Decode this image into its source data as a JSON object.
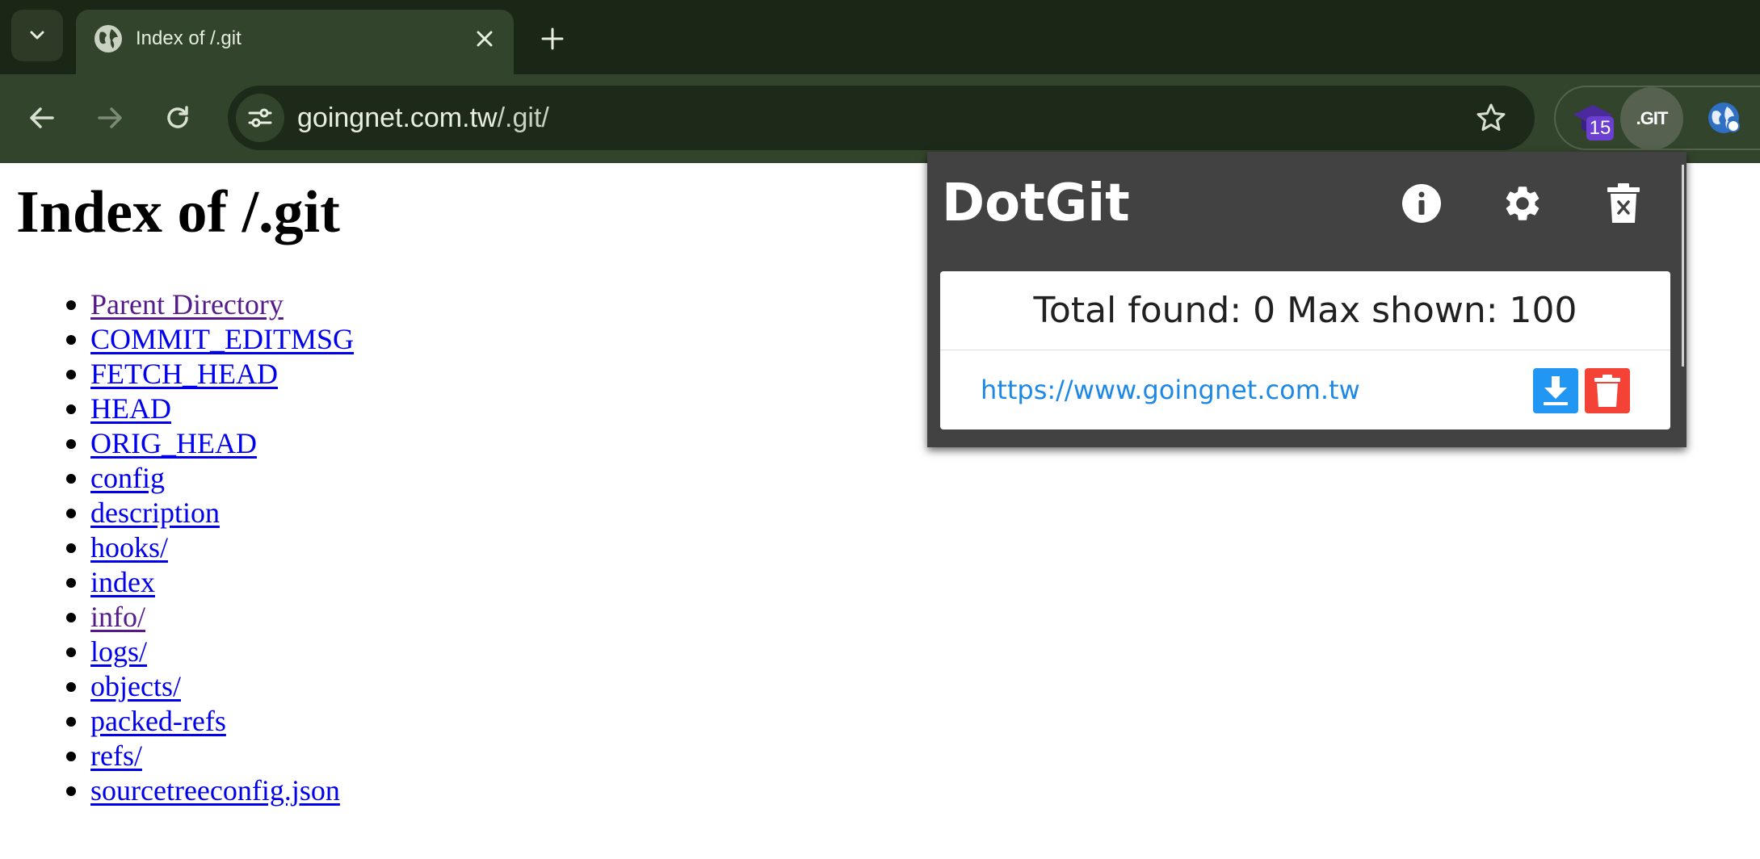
{
  "browser": {
    "tab": {
      "title": "Index of /.git"
    },
    "address": {
      "host": "goingnet.com.tw",
      "path": "/.git/"
    },
    "extensions": {
      "badge_count": "15",
      "dotgit_label": ".GIT"
    },
    "icons": {
      "tab_menu": "chevron-down-icon",
      "tab_favicon": "globe-icon",
      "tab_close": "close-icon",
      "new_tab": "plus-icon",
      "back": "arrow-left-icon",
      "forward": "arrow-right-icon",
      "reload": "reload-icon",
      "site_info": "tune-icon",
      "bookmark": "star-icon"
    },
    "colors": {
      "frame": "#1b2716",
      "toolbar": "#33442c",
      "omnibox": "#1e2a19"
    }
  },
  "page": {
    "heading": "Index of /.git",
    "files": [
      {
        "label": "Parent Directory",
        "visited": true
      },
      {
        "label": "COMMIT_EDITMSG",
        "visited": false
      },
      {
        "label": "FETCH_HEAD",
        "visited": false
      },
      {
        "label": "HEAD",
        "visited": false
      },
      {
        "label": "ORIG_HEAD",
        "visited": false
      },
      {
        "label": "config",
        "visited": false
      },
      {
        "label": "description",
        "visited": false
      },
      {
        "label": "hooks/",
        "visited": false
      },
      {
        "label": "index",
        "visited": false
      },
      {
        "label": "info/",
        "visited": true
      },
      {
        "label": "logs/",
        "visited": false
      },
      {
        "label": "objects/",
        "visited": false
      },
      {
        "label": "packed-refs",
        "visited": false
      },
      {
        "label": "refs/",
        "visited": false
      },
      {
        "label": "sourcetreeconfig.json",
        "visited": false
      }
    ],
    "colors": {
      "link": "#0000ee",
      "visited_link": "#551a8b"
    }
  },
  "popup": {
    "title": "DotGit",
    "summary": "Total found: 0 Max shown: 100",
    "site": "https://www.goingnet.com.tw",
    "icons": {
      "about": "info-icon",
      "settings": "gear-icon",
      "clear_all": "trash-x-icon",
      "download": "download-icon",
      "delete": "trash-icon"
    },
    "colors": {
      "header": "#424242",
      "link": "#1e88e5",
      "download": "#2196f3",
      "delete": "#f44336"
    }
  }
}
